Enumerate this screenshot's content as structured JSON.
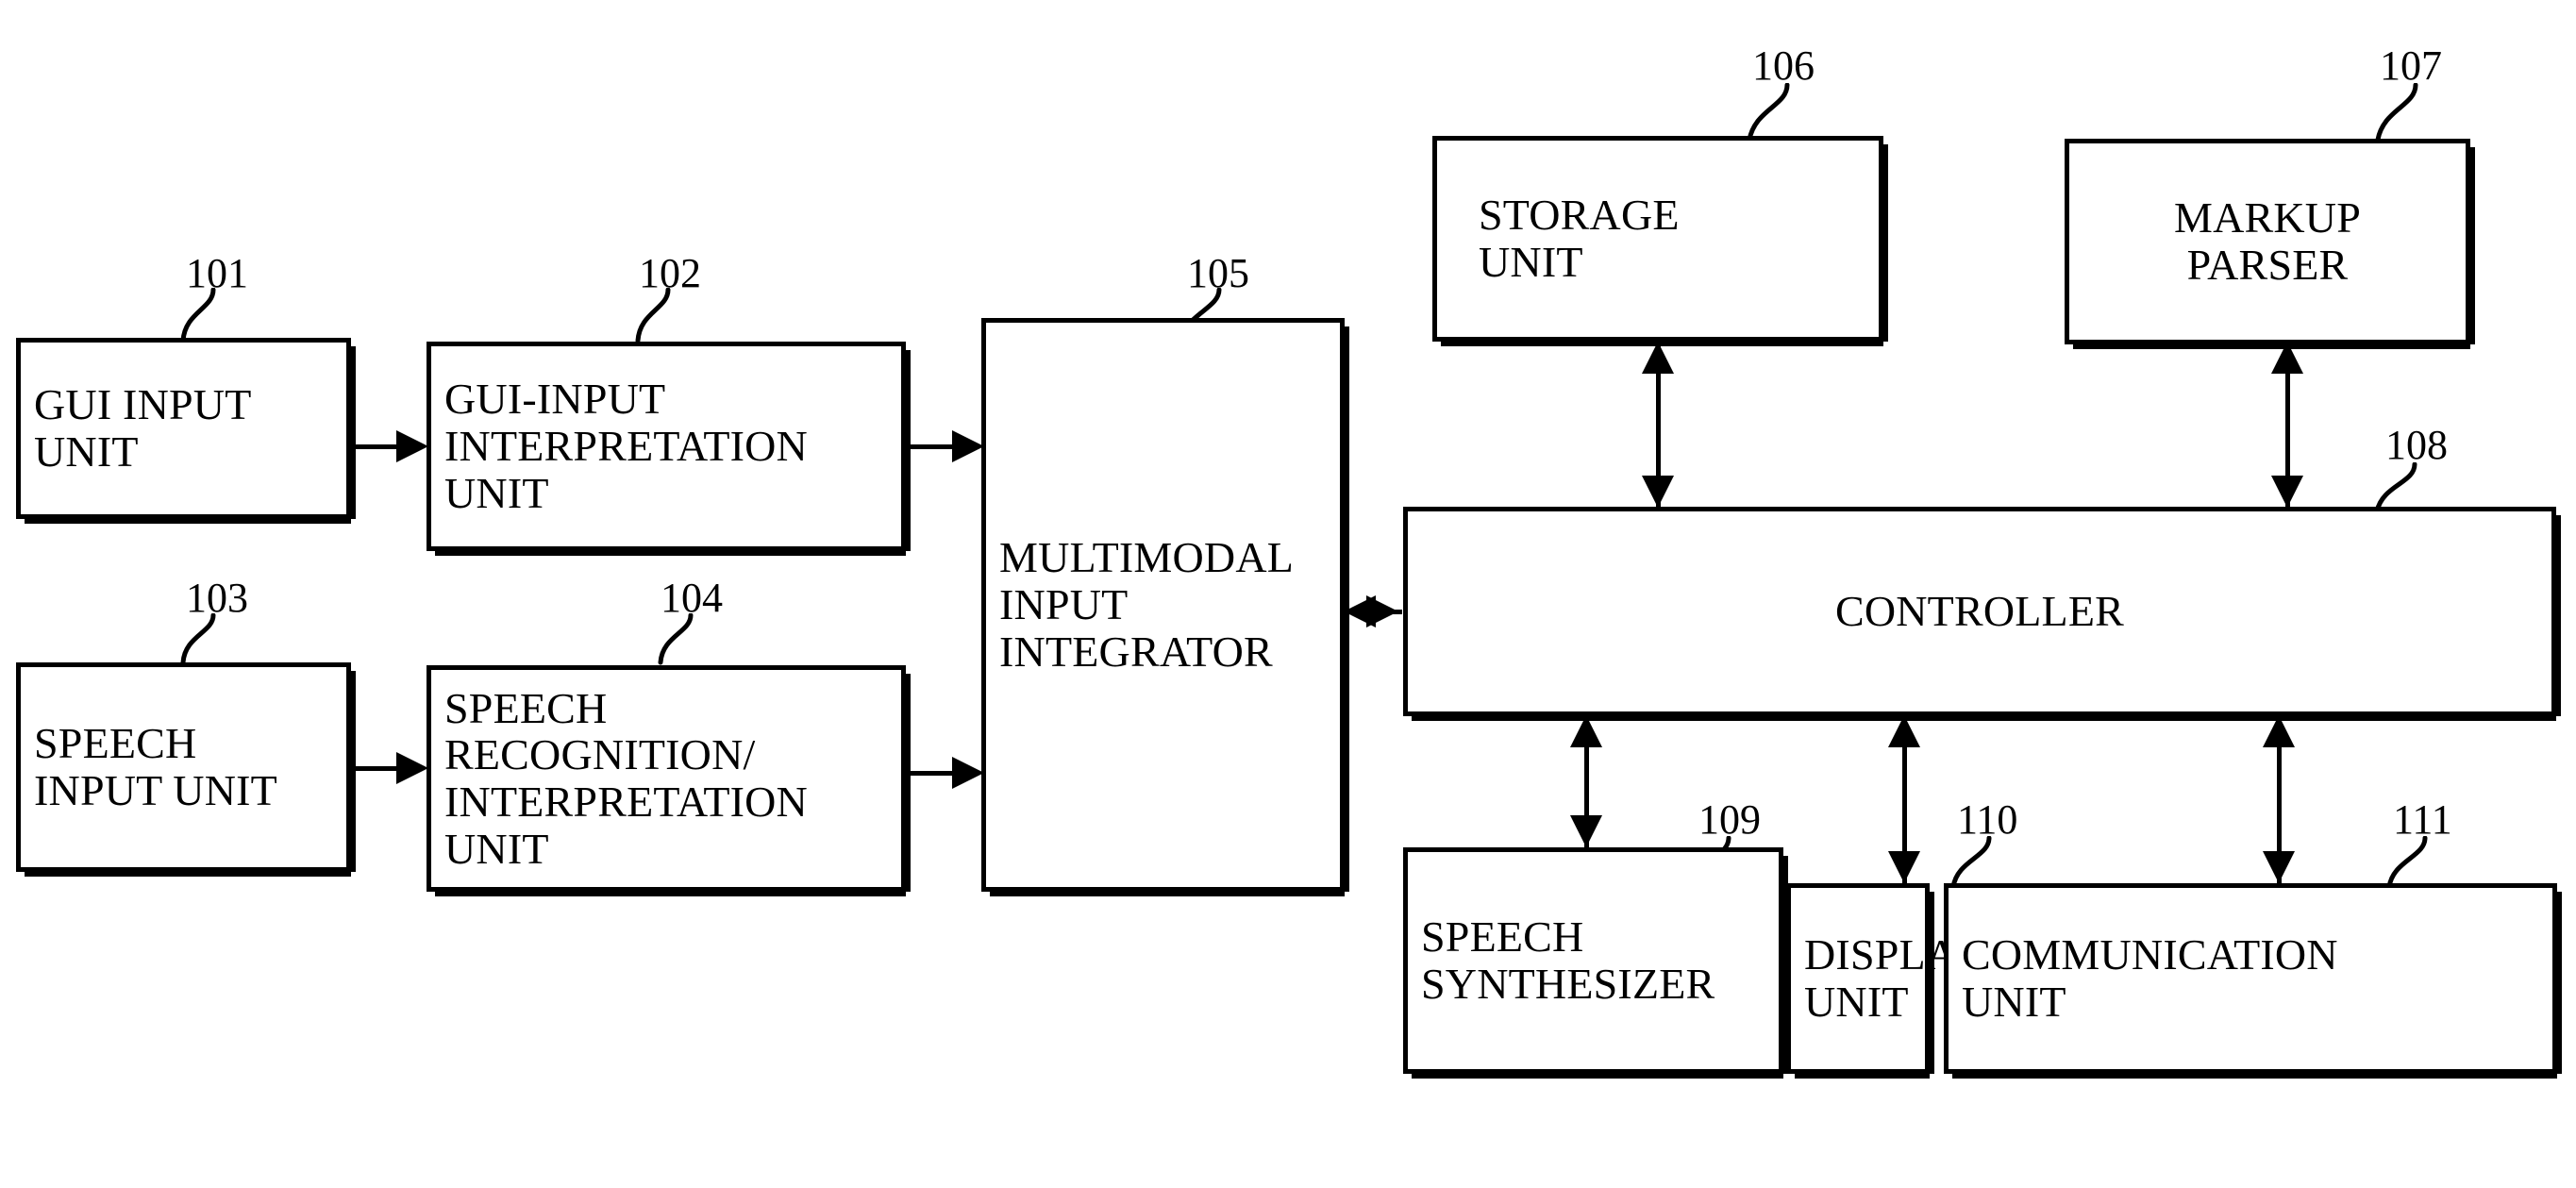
{
  "figure": {
    "type": "patent-block-diagram",
    "background_color": "#ffffff",
    "line_color": "#000000"
  },
  "blocks": [
    {
      "ref": "101",
      "label": "GUI INPUT\nUNIT"
    },
    {
      "ref": "102",
      "label": "GUI-INPUT\nINTERPRETATION\nUNIT"
    },
    {
      "ref": "103",
      "label": "SPEECH\nINPUT UNIT"
    },
    {
      "ref": "104",
      "label": "SPEECH\nRECOGNITION/\nINTERPRETATION\nUNIT"
    },
    {
      "ref": "105",
      "label": "MULTIMODAL\nINPUT\nINTEGRATOR"
    },
    {
      "ref": "106",
      "label": "STORAGE\nUNIT"
    },
    {
      "ref": "107",
      "label": "MARKUP\nPARSER"
    },
    {
      "ref": "108",
      "label": "CONTROLLER"
    },
    {
      "ref": "109",
      "label": "SPEECH\nSYNTHESIZER"
    },
    {
      "ref": "110",
      "label": "DISPLAY\nUNIT"
    },
    {
      "ref": "111",
      "label": "COMMUNICATION\nUNIT"
    }
  ],
  "connections": [
    {
      "from": "101",
      "to": "102",
      "style": "single-arrow",
      "direction": "right"
    },
    {
      "from": "102",
      "to": "105",
      "style": "single-arrow",
      "direction": "right"
    },
    {
      "from": "103",
      "to": "104",
      "style": "single-arrow",
      "direction": "right"
    },
    {
      "from": "104",
      "to": "105",
      "style": "single-arrow",
      "direction": "right"
    },
    {
      "from": "105",
      "to": "108",
      "style": "double-arrow",
      "direction": "horizontal"
    },
    {
      "from": "106",
      "to": "108",
      "style": "double-arrow",
      "direction": "vertical"
    },
    {
      "from": "107",
      "to": "108",
      "style": "double-arrow",
      "direction": "vertical"
    },
    {
      "from": "108",
      "to": "109",
      "style": "double-arrow",
      "direction": "vertical"
    },
    {
      "from": "108",
      "to": "110",
      "style": "double-arrow",
      "direction": "vertical"
    },
    {
      "from": "108",
      "to": "111",
      "style": "double-arrow",
      "direction": "vertical"
    }
  ]
}
